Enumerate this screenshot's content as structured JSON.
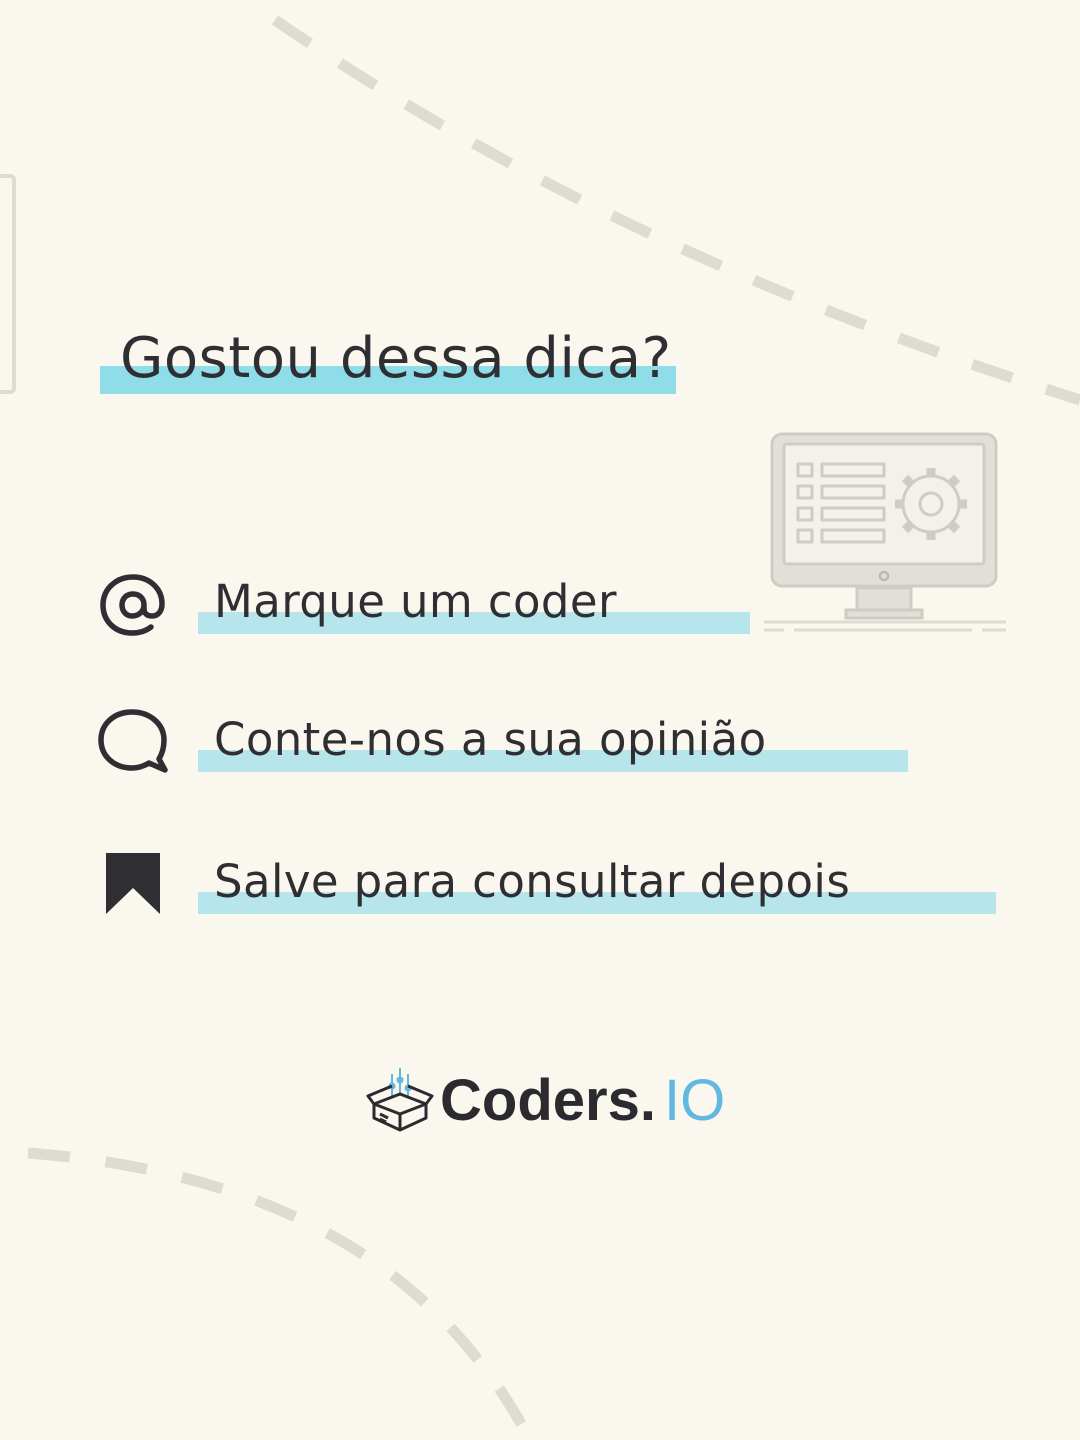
{
  "headline": "Gostou dessa dica?",
  "actions": [
    {
      "icon": "at-sign-icon",
      "label": "Marque um coder"
    },
    {
      "icon": "speech-bubble-icon",
      "label": "Conte-nos a sua opinião"
    },
    {
      "icon": "bookmark-icon",
      "label": "Salve para consultar depois"
    }
  ],
  "illustration": {
    "icon": "monitor-settings-icon"
  },
  "brand": {
    "name": "Coders.",
    "suffix": "IO",
    "icon": "open-box-logo-icon"
  },
  "colors": {
    "background": "#f9f7ee",
    "text": "#2f2f33",
    "headline_highlight": "#8fdde9",
    "item_highlight": "#b6e5ec",
    "brand_accent": "#63b8e2",
    "decor": "#dedbd2"
  }
}
